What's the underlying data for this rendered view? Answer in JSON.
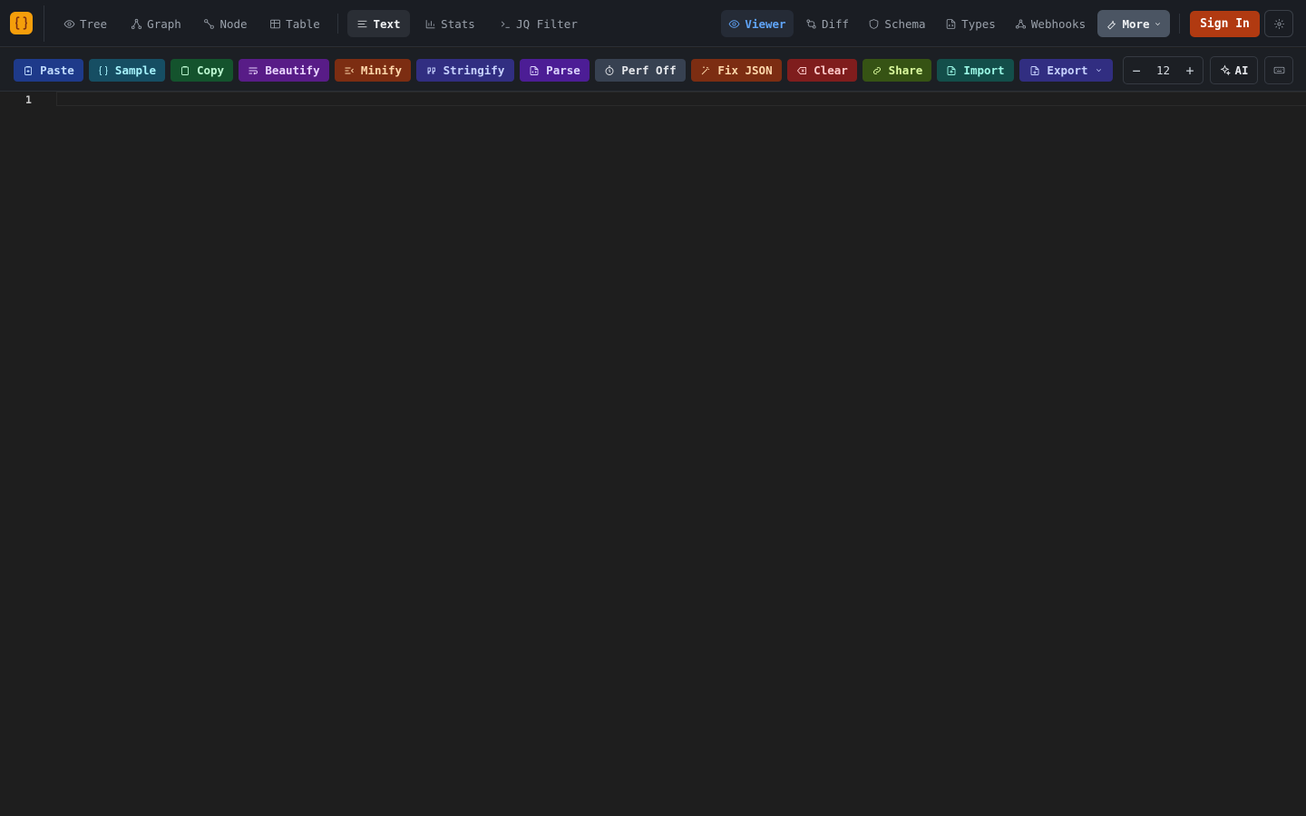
{
  "app": {
    "logo_icon": "braces-logo-icon",
    "accent": "#f59e0b"
  },
  "view_tabs": [
    {
      "label": "Tree",
      "icon": "eye-icon"
    },
    {
      "label": "Graph",
      "icon": "graph-icon"
    },
    {
      "label": "Node",
      "icon": "node-icon"
    },
    {
      "label": "Table",
      "icon": "table-icon"
    },
    {
      "label": "Text",
      "icon": "text-lines-icon",
      "active": true
    },
    {
      "label": "Stats",
      "icon": "bar-chart-icon"
    },
    {
      "label": "JQ Filter",
      "icon": "terminal-icon"
    }
  ],
  "mode_tabs": [
    {
      "label": "Viewer",
      "icon": "eye-icon",
      "active": true
    },
    {
      "label": "Diff",
      "icon": "diff-icon"
    },
    {
      "label": "Schema",
      "icon": "shield-icon"
    },
    {
      "label": "Types",
      "icon": "file-code-icon"
    },
    {
      "label": "Webhooks",
      "icon": "webhook-icon"
    },
    {
      "label": "More",
      "icon": "wrench-icon"
    }
  ],
  "auth": {
    "sign_in_label": "Sign In",
    "color": "#b13a11"
  },
  "toolbar": {
    "buttons": [
      {
        "label": "Paste",
        "icon": "clipboard-paste-icon",
        "bg": "#1e3a8a",
        "fg": "#bfdbfe"
      },
      {
        "label": "Sample",
        "icon": "braces-icon",
        "bg": "#164e63",
        "fg": "#a5f3fc"
      },
      {
        "label": "Copy",
        "icon": "clipboard-icon",
        "bg": "#14532d",
        "fg": "#bbf7d0"
      },
      {
        "label": "Beautify",
        "icon": "wrap-text-icon",
        "bg": "#581c87",
        "fg": "#e9d5ff"
      },
      {
        "label": "Minify",
        "icon": "minify-icon",
        "bg": "#7c2d12",
        "fg": "#fed7aa"
      },
      {
        "label": "Stringify",
        "icon": "quote-icon",
        "bg": "#312e81",
        "fg": "#c7d2fe"
      },
      {
        "label": "Parse",
        "icon": "file-code-icon",
        "bg": "#4c1d95",
        "fg": "#ddd6fe"
      },
      {
        "label": "Perf Off",
        "icon": "timer-icon",
        "bg": "#374151",
        "fg": "#e5e7eb"
      },
      {
        "label": "Fix JSON",
        "icon": "wand-icon",
        "bg": "#7c2d12",
        "fg": "#fed7aa"
      },
      {
        "label": "Clear",
        "icon": "eraser-icon",
        "bg": "#7f1d1d",
        "fg": "#fecaca"
      },
      {
        "label": "Share",
        "icon": "link-icon",
        "bg": "#365314",
        "fg": "#d9f99d"
      },
      {
        "label": "Import",
        "icon": "file-up-icon",
        "bg": "#134e4a",
        "fg": "#99f6e4"
      },
      {
        "label": "Export",
        "icon": "file-down-icon",
        "bg": "#312e81",
        "fg": "#c7d2fe"
      }
    ],
    "font_size": {
      "value": "12",
      "decrement_label": "−",
      "increment_label": "+"
    },
    "ai_label": "AI"
  },
  "editor": {
    "line_numbers": [
      "1"
    ],
    "content": ""
  }
}
